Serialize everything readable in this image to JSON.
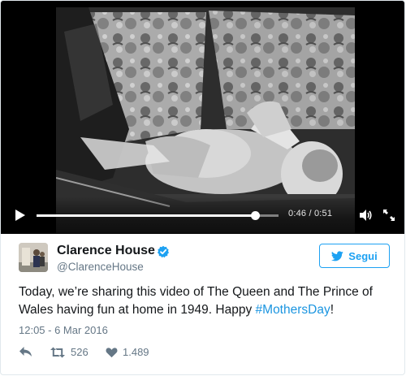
{
  "video": {
    "time_display": "0:46 / 0:51",
    "progress_fraction": 0.902,
    "icons": {
      "play": "play-icon",
      "volume": "volume-icon",
      "fullscreen": "fullscreen-icon"
    }
  },
  "author": {
    "name": "Clarence House",
    "handle": "@ClarenceHouse",
    "verified": true
  },
  "follow_button": {
    "label": "Segui",
    "icon": "twitter-bird-icon"
  },
  "tweet": {
    "text_before": "Today, we’re sharing this video of The Queen and The Prince of Wales having fun at home in 1949. Happy ",
    "hashtag": "#MothersDay",
    "text_after": "!",
    "timestamp": "12:05 - 6 Mar 2016"
  },
  "actions": {
    "reply_icon": "reply-icon",
    "retweet_icon": "retweet-icon",
    "retweet_count": "526",
    "like_icon": "heart-icon",
    "like_count": "1.489"
  },
  "colors": {
    "accent": "#1da1f2",
    "hashtag": "#1b95e0",
    "muted": "#657786"
  }
}
